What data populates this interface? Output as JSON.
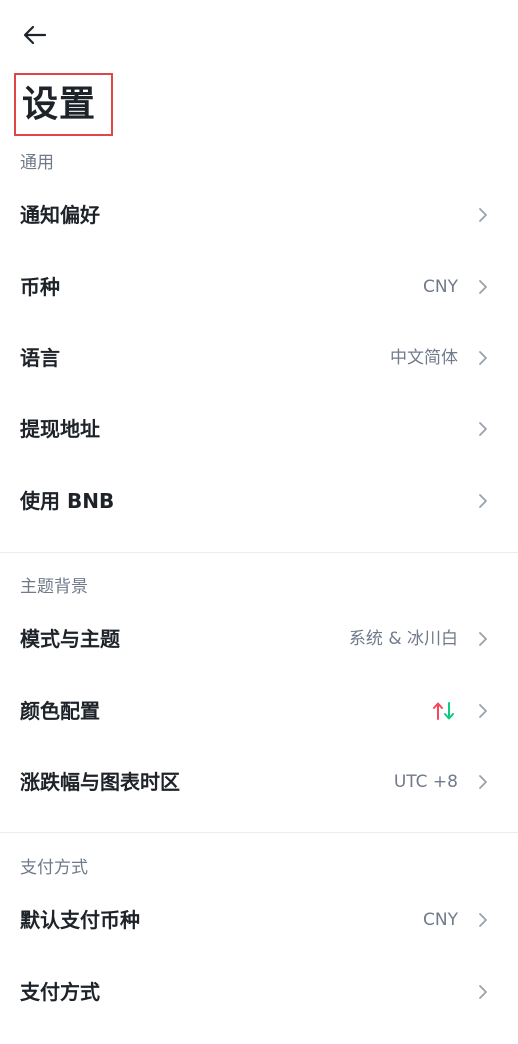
{
  "header": {
    "title": "设置",
    "back_icon": "arrow-left-icon"
  },
  "sections": {
    "general": {
      "header": "通用",
      "items": [
        {
          "label": "通知偏好",
          "value": ""
        },
        {
          "label": "币种",
          "value": "CNY"
        },
        {
          "label": "语言",
          "value": "中文简体"
        },
        {
          "label": "提现地址",
          "value": ""
        },
        {
          "label": "使用 BNB",
          "value": ""
        }
      ]
    },
    "theme": {
      "header": "主题背景",
      "items": [
        {
          "label": "模式与主题",
          "value": "系统 & 冰川白"
        },
        {
          "label": "颜色配置",
          "value_icon": "up-down-arrows-icon"
        },
        {
          "label": "涨跌幅与图表时区",
          "value": "UTC +8"
        }
      ]
    },
    "payment": {
      "header": "支付方式",
      "items": [
        {
          "label": "默认支付币种",
          "value": "CNY"
        },
        {
          "label": "支付方式",
          "value": ""
        }
      ]
    }
  },
  "colors": {
    "text_primary": "#1e2329",
    "text_secondary": "#707a8a",
    "title_outline": "#e04646",
    "up": "#f6465d",
    "down": "#0ecb81",
    "divider": "#eaecef"
  }
}
